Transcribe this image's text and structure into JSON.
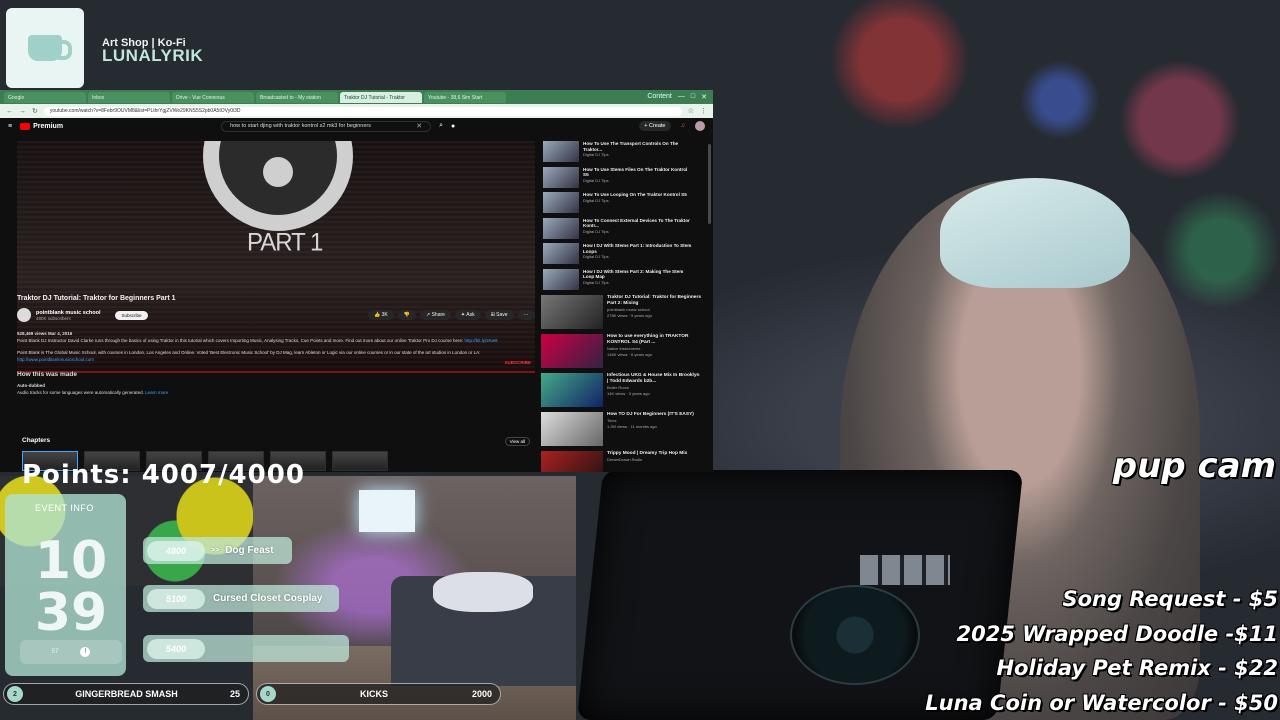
{
  "kofi": {
    "subtitle": "Art Shop | Ko-Fi",
    "name": "LUNALYRIK"
  },
  "browser": {
    "tabs": [
      "Google",
      "Inbox",
      "Drive - Vue Connexus",
      "Broadcasted to - My station",
      "Traktor DJ Tutorial - Traktor",
      "Youtube - 38,6 Sim Start"
    ],
    "active_tab": 4,
    "tab_right": [
      "Content",
      "—",
      "□",
      "✕"
    ],
    "url": "youtube.com/watch?v=8Febr9OUVM8&list=PLthrYgjZVWe29KNS5S2pb0A5tOVy0i3D"
  },
  "youtube": {
    "logo": "Premium",
    "search": "how to start djing with traktor kontrol s2 mk3 for beginners",
    "create": "Create",
    "badge": "9+",
    "player_title": "PART 1",
    "player_subscribe": "SUBSCRIBE",
    "video_title": "Traktor DJ Tutorial: Traktor for Beginners Part 1",
    "channel": {
      "name": "pointblank music school",
      "subs": "480K subscribers",
      "subscribe": "Subscribe"
    },
    "actions": [
      "3K",
      "Share",
      "Ask",
      "Save",
      "···"
    ],
    "desc": {
      "meta": "528,469 views  Mar 4, 2016",
      "line1": "Point Blank DJ Instructor David Clarke runs through the basics of using Traktor in this tutorial which covers Importing Music, Analysing Tracks, Cue Points and more. Find out more about our online Traktor Pro DJ course here:",
      "link1": "http://bit.ly/2Kw9",
      "line2": "Point Blank is The Global Music School, with courses in London, Los Angeles and Online. Voted 'Best Electronic Music School' by DJ Mag, learn Ableton or Logic via our online courses or in our state of the art studios in London or LA:",
      "link2": "http://www.pointblankmusicschool.com",
      "how_made": "How this was made",
      "auto_dub": "Auto-dubbed",
      "auto_dub_text": "Audio tracks for some languages were automatically generated.",
      "learn_more": "Learn more"
    },
    "chapters_title": "Chapters",
    "view_all": "View all",
    "playlist": [
      {
        "title": "How To Use The Transport Controls On The Traktor...",
        "chan": "Digital DJ Tips"
      },
      {
        "title": "How To Use Stems Files On The Traktor Kontrol S5",
        "chan": "Digital DJ Tips"
      },
      {
        "title": "How To Use Looping On The Traktor Kontrol S5",
        "chan": "Digital DJ Tips"
      },
      {
        "title": "How To Connect External Devices To The Traktor Kontr...",
        "chan": "Digital DJ Tips"
      },
      {
        "title": "How I DJ With Stems Part 1: Introduction To Stem Loops",
        "chan": "Digital DJ Tips"
      },
      {
        "title": "How I DJ With Stems Part 2: Making The Stem Loop Map",
        "chan": "Digital DJ Tips"
      }
    ],
    "related": [
      {
        "title": "Traktor DJ Tutorial: Traktor for Beginners Part 2: Mixing",
        "chan": "pointblank music school",
        "meta": "278K views · 9 years ago"
      },
      {
        "title": "How to use everything in TRAKTOR KONTROL S4 (Part ...",
        "chan": "Native Instruments",
        "meta": "146K views · 6 years ago"
      },
      {
        "title": "Infectious UKG & House Mix In Brooklyn | Todd Edwards b2b...",
        "chan": "Boiler Room",
        "meta": "14K views · 3 years ago"
      },
      {
        "title": "How TO DJ For Beginners (IT'S EASY)",
        "chan": "Tinez",
        "meta": "1.2M views · 11 months ago"
      },
      {
        "title": "Trippy Mood | Dreamy Trip Hop Mix",
        "chan": "DreamDrawn Radio",
        "meta": ""
      }
    ]
  },
  "overlay": {
    "pup_cam": "pup cam",
    "price_list": [
      "Song Request - $5",
      "2025 Wrapped Doodle -$11",
      "Holiday Pet Remix - $22",
      "Luna Coin or Watercolor - $50"
    ],
    "points_banner": "Points: 4007/4000",
    "event_label": "EVENT INFO",
    "event_num_top": "10",
    "event_num_bottom": "39",
    "event_small": [
      "57",
      "!"
    ],
    "goals": [
      {
        "cost": "4800",
        "name": "Dog Feast",
        "icon": ">>"
      },
      {
        "cost": "5100",
        "name": "Cursed Closet Cosplay",
        "icon": ""
      },
      {
        "cost": "5400",
        "name": "",
        "icon": ""
      }
    ],
    "bar_left": {
      "bubble": "2",
      "label": "GINGERBREAD SMASH",
      "value": "25"
    },
    "bar_right": {
      "bubble": "0",
      "label": "KICKS",
      "value": "2000"
    }
  }
}
